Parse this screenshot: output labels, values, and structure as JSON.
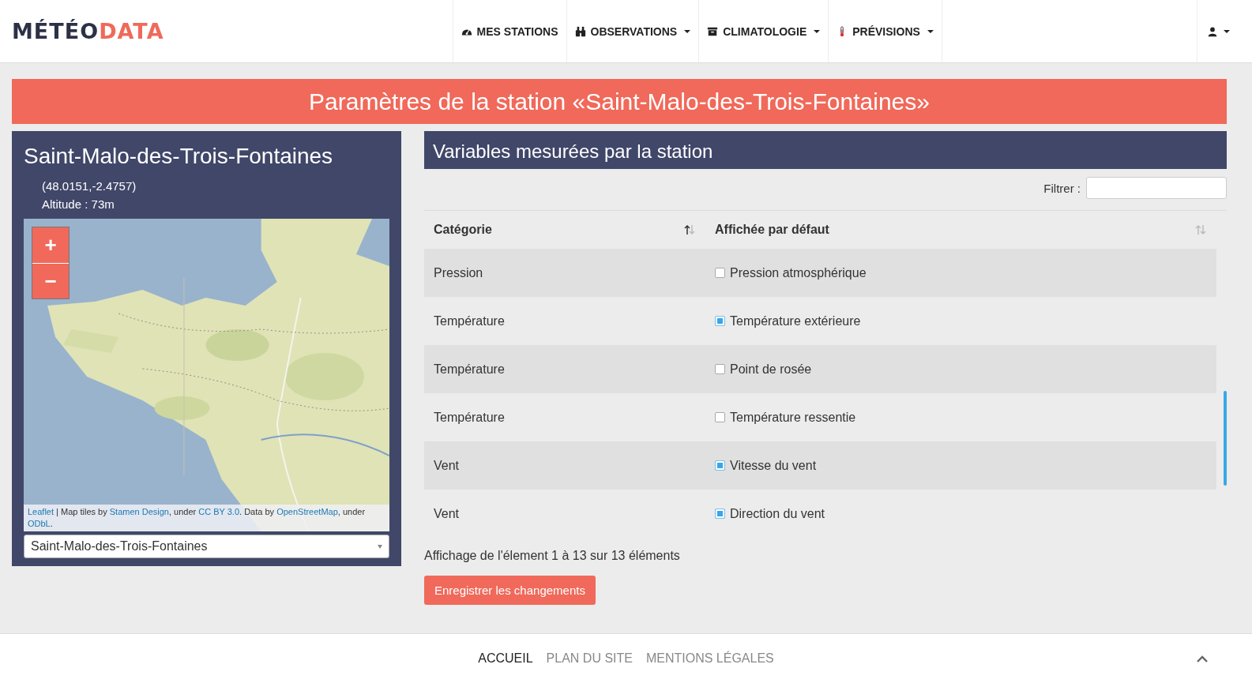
{
  "logo": {
    "part_1": "MÉTÉO",
    "part_2": "DATA"
  },
  "nav": [
    {
      "label": "MES STATIONS",
      "dropdown": false
    },
    {
      "label": "OBSERVATIONS",
      "dropdown": true
    },
    {
      "label": "CLIMATOLOGIE",
      "dropdown": true
    },
    {
      "label": "PRÉVISIONS",
      "dropdown": true
    }
  ],
  "banner": "Paramètres de la station «Saint-Malo-des-Trois-Fontaines»",
  "station": {
    "name": "Saint-Malo-des-Trois-Fontaines",
    "coords": "(48.0151,-2.4757)",
    "altitude": "Altitude : 73m",
    "map": {
      "kind": "picture",
      "zoom_in": "+",
      "zoom_out": "−",
      "attribution": [
        {
          "kind": "link",
          "text": "Leaflet"
        },
        {
          "kind": "text",
          "text": " | Map tiles by "
        },
        {
          "kind": "link",
          "text": "Stamen Design"
        },
        {
          "kind": "text",
          "text": ", under "
        },
        {
          "kind": "link",
          "text": "CC BY 3.0"
        },
        {
          "kind": "text",
          "text": ". Data by "
        },
        {
          "kind": "link",
          "text": "OpenStreetMap"
        },
        {
          "kind": "text",
          "text": ", under "
        },
        {
          "kind": "link",
          "text": "ODbL"
        },
        {
          "kind": "text",
          "text": "."
        }
      ]
    },
    "select_value": "Saint-Malo-des-Trois-Fontaines"
  },
  "variables": {
    "title": "Variables mesurées par la station",
    "filter_label": "Filtrer :",
    "columns": [
      {
        "label": "Catégorie",
        "sorted": true
      },
      {
        "label": "Affichée par défaut",
        "sorted": false
      }
    ],
    "rows": [
      {
        "category": "Pression",
        "variable": "Pression atmosphérique",
        "checked": false
      },
      {
        "category": "Température",
        "variable": "Température extérieure",
        "checked": true
      },
      {
        "category": "Température",
        "variable": "Point de rosée",
        "checked": false
      },
      {
        "category": "Température",
        "variable": "Température ressentie",
        "checked": false
      },
      {
        "category": "Vent",
        "variable": "Vitesse du vent",
        "checked": true
      },
      {
        "category": "Vent",
        "variable": "Direction du vent",
        "checked": true
      }
    ],
    "info": "Affichage de l'élement 1 à 13 sur 13 éléments",
    "save_button": "Enregistrer les changements"
  },
  "footer": [
    {
      "label": "ACCUEIL",
      "selected": true
    },
    {
      "label": "PLAN DU SITE",
      "selected": false
    },
    {
      "label": "MENTIONS LÉGALES",
      "selected": false
    }
  ]
}
